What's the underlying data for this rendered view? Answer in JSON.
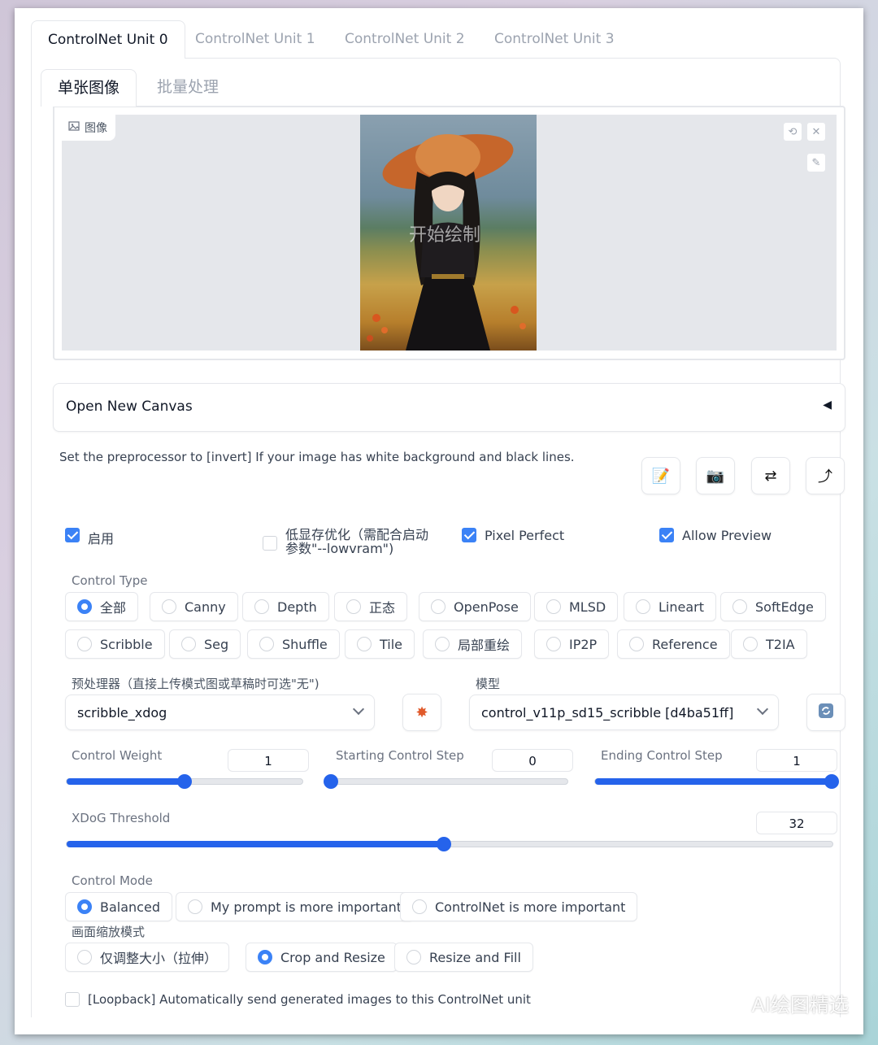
{
  "tabs": [
    "ControlNet Unit 0",
    "ControlNet Unit 1",
    "ControlNet Unit 2",
    "ControlNet Unit 3"
  ],
  "inner_tabs": [
    "单张图像",
    "批量处理"
  ],
  "image": {
    "label": "图像",
    "overlay_text": "开始绘制"
  },
  "accordion": {
    "title": "Open New Canvas",
    "arrow": "◀"
  },
  "hint": "Set the preprocessor to [invert] If your image has white background and black lines.",
  "tool_buttons": [
    "📝",
    "📷",
    "⇄",
    "⤴"
  ],
  "checkboxes": {
    "enable": {
      "label": "启用",
      "checked": true
    },
    "lowvram": {
      "label_line1": "低显存优化（需配合启动",
      "label_line2": "参数\"--lowvram\")",
      "checked": false
    },
    "pixel_perfect": {
      "label": "Pixel Perfect",
      "checked": true
    },
    "allow_preview": {
      "label": "Allow Preview",
      "checked": true
    }
  },
  "control_type": {
    "label": "Control Type",
    "row1": [
      "全部",
      "Canny",
      "Depth",
      "正态",
      "OpenPose",
      "MLSD",
      "Lineart",
      "SoftEdge"
    ],
    "row2": [
      "Scribble",
      "Seg",
      "Shuffle",
      "Tile",
      "局部重绘",
      "IP2P",
      "Reference",
      "T2IA"
    ],
    "selected": "全部"
  },
  "preprocessor": {
    "label": "预处理器（直接上传模式图或草稿时可选\"无\")",
    "value": "scribble_xdog"
  },
  "model": {
    "label": "模型",
    "value": "control_v11p_sd15_scribble [d4ba51ff]"
  },
  "sliders": {
    "control_weight": {
      "label": "Control Weight",
      "value": "1",
      "fraction": 0.5
    },
    "starting_step": {
      "label": "Starting Control Step",
      "value": "0",
      "fraction": 0.0
    },
    "ending_step": {
      "label": "Ending Control Step",
      "value": "1",
      "fraction": 1.0
    },
    "xdog_threshold": {
      "label": "XDoG Threshold",
      "value": "32",
      "fraction": 0.493
    }
  },
  "control_mode": {
    "label": "Control Mode",
    "options": [
      "Balanced",
      "My prompt is more important",
      "ControlNet is more important"
    ],
    "selected": "Balanced"
  },
  "resize_mode": {
    "label": "画面缩放模式",
    "options": [
      "仅调整大小（拉伸）",
      "Crop and Resize",
      "Resize and Fill"
    ],
    "selected": "Crop and Resize"
  },
  "loopback": {
    "label": "[Loopback] Automatically send generated images to this ControlNet unit",
    "checked": false
  },
  "watermark": "AI绘图精选",
  "colors": {
    "accent": "#2563eb",
    "border": "#e5e7eb"
  }
}
